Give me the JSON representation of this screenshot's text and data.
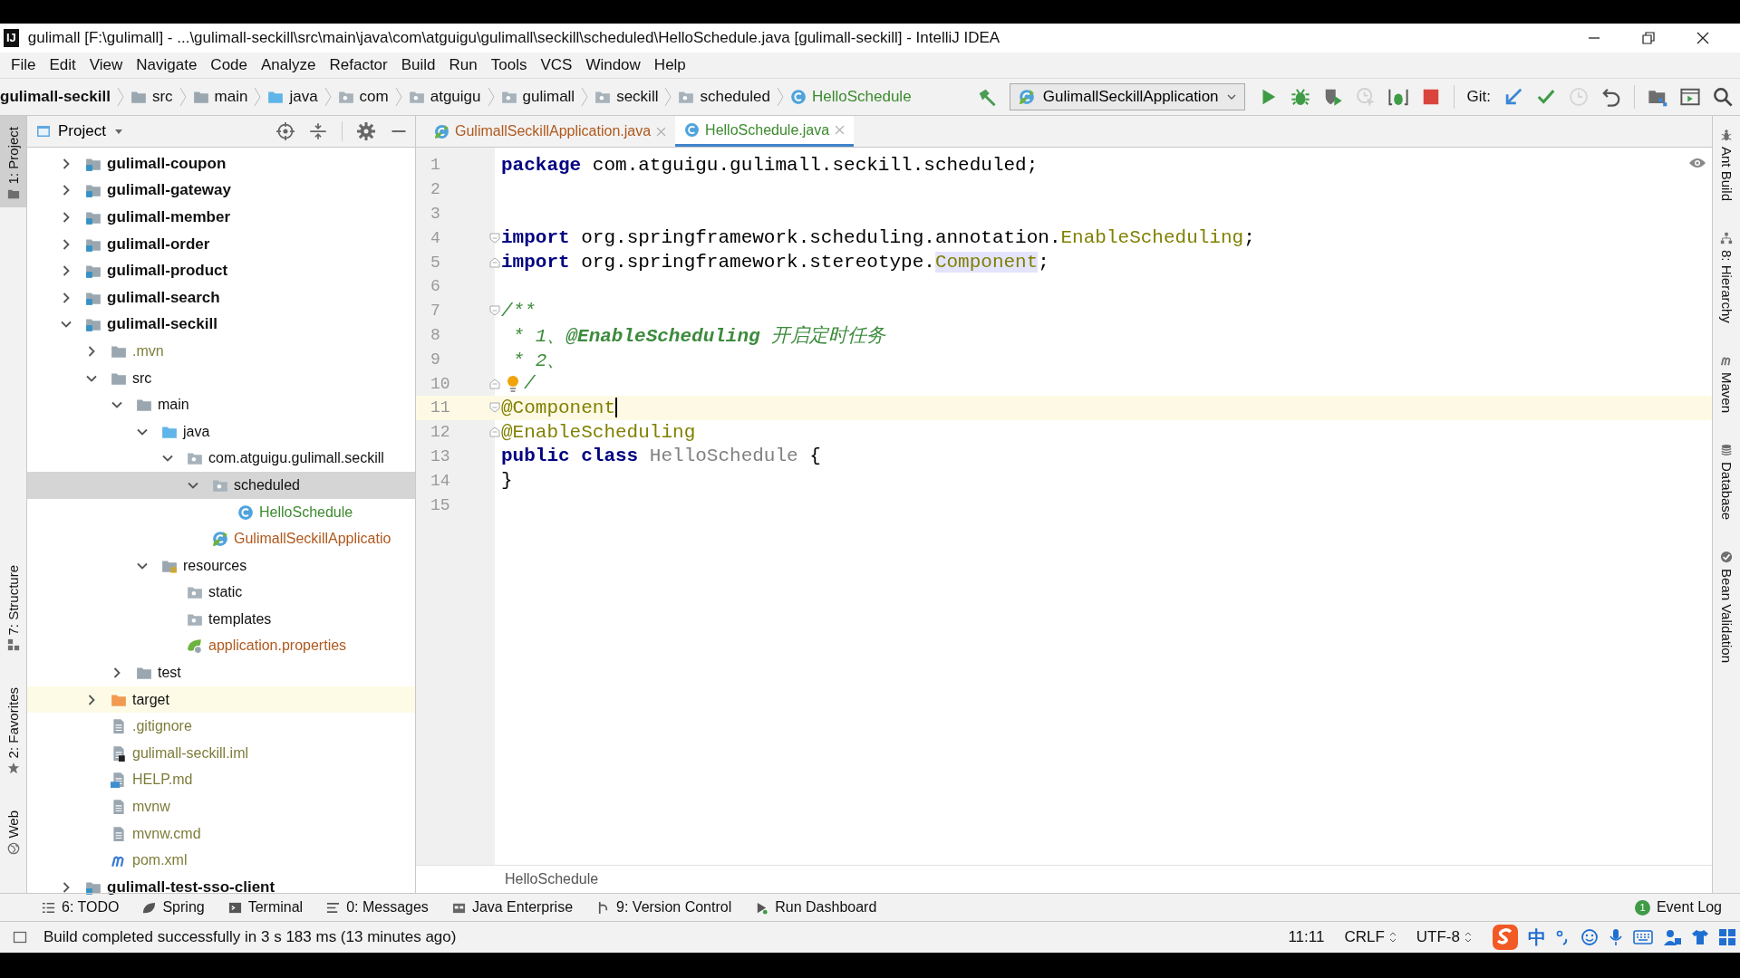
{
  "window": {
    "logo": "IJ",
    "title": "gulimall [F:\\gulimall] - ...\\gulimall-seckill\\src\\main\\java\\com\\atguigu\\gulimall\\seckill\\scheduled\\HelloSchedule.java [gulimall-seckill] - IntelliJ IDEA"
  },
  "menu": [
    "File",
    "Edit",
    "View",
    "Navigate",
    "Code",
    "Analyze",
    "Refactor",
    "Build",
    "Run",
    "Tools",
    "VCS",
    "Window",
    "Help"
  ],
  "breadcrumbs": [
    {
      "label": "gulimall-seckill",
      "kind": "module"
    },
    {
      "label": "src",
      "kind": "folder"
    },
    {
      "label": "main",
      "kind": "folder"
    },
    {
      "label": "java",
      "kind": "source-root"
    },
    {
      "label": "com",
      "kind": "package"
    },
    {
      "label": "atguigu",
      "kind": "package"
    },
    {
      "label": "gulimall",
      "kind": "package"
    },
    {
      "label": "seckill",
      "kind": "package"
    },
    {
      "label": "scheduled",
      "kind": "package"
    },
    {
      "label": "HelloSchedule",
      "kind": "class"
    }
  ],
  "run_config": "GulimallSeckillApplication",
  "toolbar": [
    {
      "kind": "build",
      "disabled": false
    },
    {
      "kind": "config"
    },
    {
      "kind": "run",
      "disabled": false
    },
    {
      "kind": "debug",
      "disabled": false
    },
    {
      "kind": "coverage",
      "disabled": false
    },
    {
      "kind": "profile",
      "disabled": true
    },
    {
      "kind": "attach",
      "disabled": false
    },
    {
      "kind": "stop",
      "disabled": false
    },
    {
      "kind": "sep"
    },
    {
      "kind": "git-label",
      "label": "Git:"
    },
    {
      "kind": "update",
      "disabled": false
    },
    {
      "kind": "commit",
      "disabled": false
    },
    {
      "kind": "history",
      "disabled": true
    },
    {
      "kind": "rollback",
      "disabled": false
    },
    {
      "kind": "sep"
    },
    {
      "kind": "structure",
      "disabled": false
    },
    {
      "kind": "frame",
      "disabled": false
    },
    {
      "kind": "search",
      "disabled": false
    }
  ],
  "left_stripe": [
    {
      "label": "1: Project",
      "kind": "project",
      "selected": true
    },
    {
      "label": "7: Structure",
      "kind": "structure",
      "selected": false
    },
    {
      "label": "2: Favorites",
      "kind": "favorites",
      "selected": false
    },
    {
      "label": "Web",
      "kind": "web",
      "selected": false
    }
  ],
  "right_stripe": [
    {
      "label": "Ant Build",
      "kind": "ant"
    },
    {
      "label": "8: Hierarchy",
      "kind": "hierarchy"
    },
    {
      "label": "Maven",
      "kind": "maven"
    },
    {
      "label": "Database",
      "kind": "database"
    },
    {
      "label": "Bean Validation",
      "kind": "bean"
    }
  ],
  "project_panel": {
    "title": "Project",
    "tree": [
      {
        "label": "gulimall-coupon",
        "kind": "module",
        "expanded": false,
        "selected": false
      },
      {
        "label": "gulimall-gateway",
        "kind": "module",
        "expanded": false,
        "selected": false
      },
      {
        "label": "gulimall-member",
        "kind": "module",
        "expanded": false,
        "selected": false
      },
      {
        "label": "gulimall-order",
        "kind": "module",
        "expanded": false,
        "selected": false
      },
      {
        "label": "gulimall-product",
        "kind": "module",
        "expanded": false,
        "selected": false
      },
      {
        "label": "gulimall-search",
        "kind": "module",
        "expanded": false,
        "selected": false
      },
      {
        "label": "gulimall-seckill",
        "kind": "module",
        "expanded": true,
        "selected": false,
        "children": [
          {
            "label": ".mvn",
            "kind": "folder",
            "expanded": false,
            "selected": false,
            "color": "#7d7d3a"
          },
          {
            "label": "src",
            "kind": "folder",
            "expanded": true,
            "selected": false,
            "children": [
              {
                "label": "main",
                "kind": "folder",
                "expanded": true,
                "selected": false,
                "children": [
                  {
                    "label": "java",
                    "kind": "source-root",
                    "expanded": true,
                    "selected": false,
                    "children": [
                      {
                        "label": "com.atguigu.gulimall.seckill",
                        "kind": "package",
                        "expanded": true,
                        "selected": false,
                        "children": [
                          {
                            "label": "scheduled",
                            "kind": "package",
                            "expanded": true,
                            "selected": true,
                            "children": [
                              {
                                "label": "HelloSchedule",
                                "kind": "class",
                                "selected": false,
                                "color": "#3c8a2e"
                              }
                            ]
                          },
                          {
                            "label": "GulimallSeckillApplicatio",
                            "kind": "spring-class",
                            "selected": false,
                            "color": "#b0591d"
                          }
                        ]
                      }
                    ]
                  },
                  {
                    "label": "resources",
                    "kind": "resource-root",
                    "expanded": true,
                    "selected": false,
                    "children": [
                      {
                        "label": "static",
                        "kind": "package",
                        "selected": false
                      },
                      {
                        "label": "templates",
                        "kind": "package",
                        "selected": false
                      },
                      {
                        "label": "application.properties",
                        "kind": "spring-config",
                        "selected": false,
                        "color": "#b0591d"
                      }
                    ]
                  }
                ]
              },
              {
                "label": "test",
                "kind": "folder",
                "expanded": false,
                "selected": false
              }
            ]
          },
          {
            "label": "target",
            "kind": "excluded",
            "expanded": false,
            "selected": false
          },
          {
            "label": ".gitignore",
            "kind": "file",
            "selected": false,
            "color": "#7d7d3a"
          },
          {
            "label": "gulimall-seckill.iml",
            "kind": "iml",
            "selected": false,
            "color": "#7d7d3a"
          },
          {
            "label": "HELP.md",
            "kind": "md",
            "selected": false,
            "color": "#7d7d3a"
          },
          {
            "label": "mvnw",
            "kind": "file",
            "selected": false,
            "color": "#7d7d3a"
          },
          {
            "label": "mvnw.cmd",
            "kind": "file",
            "selected": false,
            "color": "#7d7d3a"
          },
          {
            "label": "pom.xml",
            "kind": "maven",
            "selected": false,
            "color": "#7d7d3a"
          }
        ]
      },
      {
        "label": "gulimall-test-sso-client",
        "kind": "module",
        "expanded": false,
        "selected": false
      }
    ]
  },
  "editor_tabs": [
    {
      "label": "GulimallSeckillApplication.java",
      "kind": "spring-class",
      "color": "#b0591d",
      "selected": false
    },
    {
      "label": "HelloSchedule.java",
      "kind": "class",
      "color": "#3c8a2e",
      "selected": true
    }
  ],
  "code": [
    {
      "number": "1",
      "current": false,
      "tokens": [
        {
          "text": "package",
          "kind": "keyword"
        },
        {
          "text": " com.atguigu.gulimall.seckill.scheduled;",
          "kind": "plain"
        }
      ]
    },
    {
      "number": "2",
      "current": false
    },
    {
      "number": "3",
      "current": false
    },
    {
      "number": "4",
      "current": false,
      "fold_start": true,
      "tokens": [
        {
          "text": "import",
          "kind": "keyword"
        },
        {
          "text": " org.springframework.scheduling.annotation.",
          "kind": "plain"
        },
        {
          "text": "EnableScheduling",
          "kind": "unused"
        },
        {
          "text": ";",
          "kind": "plain"
        }
      ]
    },
    {
      "number": "5",
      "current": false,
      "fold_end": true,
      "tokens": [
        {
          "text": "import",
          "kind": "keyword"
        },
        {
          "text": " org.springframework.stereotype.",
          "kind": "plain"
        },
        {
          "text": "Component",
          "kind": "usage"
        },
        {
          "text": ";",
          "kind": "plain"
        }
      ]
    },
    {
      "number": "6",
      "current": false
    },
    {
      "number": "7",
      "current": false,
      "fold_start": true,
      "tokens": [
        {
          "text": "/**",
          "kind": "doc"
        }
      ]
    },
    {
      "number": "8",
      "current": false,
      "tokens": [
        {
          "text": " * 1、",
          "kind": "doc"
        },
        {
          "text": "@EnableScheduling",
          "kind": "doc-tag"
        },
        {
          "text": " 开启定时任务",
          "kind": "doc"
        }
      ]
    },
    {
      "number": "9",
      "current": false,
      "tokens": [
        {
          "text": " * 2、",
          "kind": "doc"
        }
      ]
    },
    {
      "number": "10",
      "current": false,
      "fold_end": true,
      "bulb": true,
      "tokens": [
        {
          "text": "/",
          "kind": "doc"
        }
      ]
    },
    {
      "number": "11",
      "current": true,
      "caret": true,
      "fold_start": true,
      "tokens": [
        {
          "text": "@Component",
          "kind": "annotation"
        }
      ]
    },
    {
      "number": "12",
      "current": false,
      "fold_end": true,
      "tokens": [
        {
          "text": "@EnableScheduling",
          "kind": "annotation"
        }
      ]
    },
    {
      "number": "13",
      "current": false,
      "tokens": [
        {
          "text": "public class",
          "kind": "keyword"
        },
        {
          "text": " HelloSchedule",
          "kind": "unused-class"
        },
        {
          "text": " {",
          "kind": "plain"
        }
      ]
    },
    {
      "number": "14",
      "current": false,
      "tokens": [
        {
          "text": "}",
          "kind": "plain"
        }
      ]
    },
    {
      "number": "15",
      "current": false
    }
  ],
  "editor_breadcrumb": "HelloSchedule",
  "tool_windows": [
    {
      "label": "6: TODO",
      "kind": "todo"
    },
    {
      "label": "Spring",
      "kind": "spring"
    },
    {
      "label": "Terminal",
      "kind": "terminal"
    },
    {
      "label": "0: Messages",
      "kind": "messages"
    },
    {
      "label": "Java Enterprise",
      "kind": "javaee"
    },
    {
      "label": "9: Version Control",
      "kind": "vcs"
    },
    {
      "label": "Run Dashboard",
      "kind": "dashboard"
    }
  ],
  "event_log": {
    "label": "Event Log",
    "count": "1"
  },
  "status_bar": {
    "message": "Build completed successfully in 3 s 183 ms (13 minutes ago)",
    "position": "11:11",
    "line_separator": "CRLF",
    "encoding": "UTF-8",
    "ime_mode": "中"
  }
}
